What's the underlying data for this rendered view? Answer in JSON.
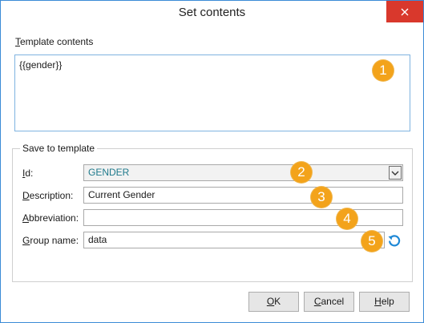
{
  "window": {
    "title": "Set contents"
  },
  "template": {
    "label_accel": "T",
    "label_rest": "emplate contents",
    "value": "{{gender}}"
  },
  "save_group": {
    "title": "Save to template",
    "id": {
      "label_accel": "I",
      "label_rest": "d:",
      "value": "GENDER"
    },
    "description": {
      "label_accel": "D",
      "label_rest": "escription:",
      "value": "Current Gender"
    },
    "abbreviation": {
      "label_accel": "A",
      "label_rest": "bbreviation:",
      "value": ""
    },
    "group": {
      "label_accel": "G",
      "label_rest": "roup name:",
      "value": "data"
    }
  },
  "badges": [
    "1",
    "2",
    "3",
    "4",
    "5"
  ],
  "buttons": {
    "ok": {
      "accel": "O",
      "rest": "K"
    },
    "cancel": {
      "accel": "C",
      "rest": "ancel"
    },
    "help": {
      "accel": "H",
      "rest": "elp"
    }
  },
  "colors": {
    "accent_border": "#3c8bd6",
    "close_red": "#d9382c",
    "badge_orange": "#f3a31b",
    "id_value_text": "#1f7a8c"
  },
  "icons": {
    "close": "close-icon",
    "dropdown": "chevron-down-icon",
    "reset": "reset-icon"
  }
}
